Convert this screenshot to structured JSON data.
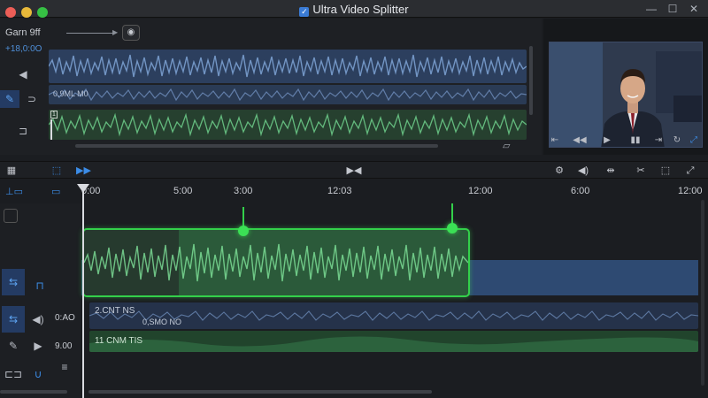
{
  "window": {
    "title": "Ultra Video Splitter",
    "controls": {
      "minimize": "—",
      "maximize": "☐",
      "close": "✕"
    }
  },
  "source_panel": {
    "dropdown_label": "Garn 9ff",
    "timecode": "+18,0:0O",
    "track_b_label": "0,9ML M0",
    "track_c_marker": "1"
  },
  "preview": {
    "controls": [
      "⇤",
      "◀◀",
      "▶",
      "▮▮",
      "⇥",
      "↻",
      "⤢"
    ]
  },
  "timeline": {
    "ruler_ticks": [
      "0:00",
      "5:00",
      "3:00",
      "12:03",
      "12:00",
      "6:00",
      "12:00"
    ],
    "tracks": {
      "audio1_label": "2.CNT NS",
      "audio1_sublabel": "0,SMO NO",
      "audio2_label": "11 CNM TIS",
      "vol_a": "0:AO",
      "vol_b": "9.00"
    }
  },
  "colors": {
    "accent_blue": "#3c8ce6",
    "split_green": "#33d04a",
    "video_track": "#2e4a72",
    "audio_track_green": "#21442c"
  }
}
